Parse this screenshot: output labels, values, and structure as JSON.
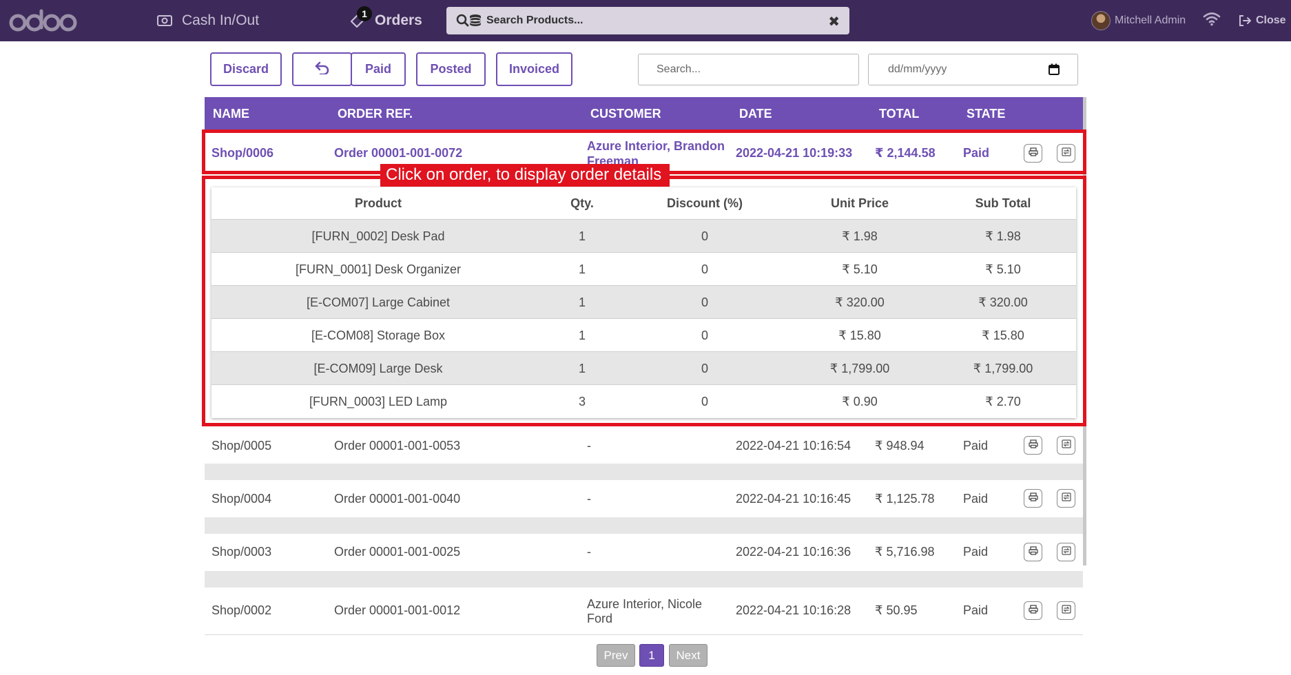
{
  "navbar": {
    "logo_text": "odoo",
    "cash_label": "Cash In/Out",
    "orders_label": "Orders",
    "orders_badge": "1",
    "search_products_label": "Search Products...",
    "clear_label": "✖",
    "user_name": "Mitchell Admin",
    "close_label": "Close"
  },
  "toolbar": {
    "discard": "Discard",
    "undo_icon": "undo-icon",
    "paid": "Paid",
    "posted": "Posted",
    "invoiced": "Invoiced",
    "search_placeholder": "Search...",
    "date_placeholder": "dd/mm/yyyy"
  },
  "table": {
    "headers": [
      "NAME",
      "ORDER REF.",
      "CUSTOMER",
      "DATE",
      "TOTAL",
      "STATE"
    ],
    "rows": [
      {
        "name": "Shop/0006",
        "ref": "Order 00001-001-0072",
        "customer1": "Azure Interior, Brandon",
        "customer2": "Freeman",
        "date": "2022-04-21 10:19:33",
        "total": "₹ 2,144.58",
        "state": "Paid"
      },
      {
        "name": "Shop/0005",
        "ref": "Order 00001-001-0053",
        "customer1": "-",
        "customer2": "",
        "date": "2022-04-21 10:16:54",
        "total": "₹ 948.94",
        "state": "Paid"
      },
      {
        "name": "Shop/0004",
        "ref": "Order 00001-001-0040",
        "customer1": "-",
        "customer2": "",
        "date": "2022-04-21 10:16:45",
        "total": "₹ 1,125.78",
        "state": "Paid"
      },
      {
        "name": "Shop/0003",
        "ref": "Order 00001-001-0025",
        "customer1": "-",
        "customer2": "",
        "date": "2022-04-21 10:16:36",
        "total": "₹ 5,716.98",
        "state": "Paid"
      },
      {
        "name": "Shop/0002",
        "ref": "Order 00001-001-0012",
        "customer1": "Azure Interior, Nicole",
        "customer2": "Ford",
        "date": "2022-04-21 10:16:28",
        "total": "₹ 50.95",
        "state": "Paid"
      }
    ]
  },
  "callout": "Click on order, to display order details",
  "details": {
    "headers": [
      "Product",
      "Qty.",
      "Discount (%)",
      "Unit Price",
      "Sub Total"
    ],
    "lines": [
      {
        "product": "[FURN_0002] Desk Pad",
        "qty": "1",
        "discount": "0",
        "unit_price": "₹ 1.98",
        "subtotal": "₹ 1.98"
      },
      {
        "product": "[FURN_0001] Desk Organizer",
        "qty": "1",
        "discount": "0",
        "unit_price": "₹ 5.10",
        "subtotal": "₹ 5.10"
      },
      {
        "product": "[E-COM07] Large Cabinet",
        "qty": "1",
        "discount": "0",
        "unit_price": "₹ 320.00",
        "subtotal": "₹ 320.00"
      },
      {
        "product": "[E-COM08] Storage Box",
        "qty": "1",
        "discount": "0",
        "unit_price": "₹ 15.80",
        "subtotal": "₹ 15.80"
      },
      {
        "product": "[E-COM09] Large Desk",
        "qty": "1",
        "discount": "0",
        "unit_price": "₹ 1,799.00",
        "subtotal": "₹ 1,799.00"
      },
      {
        "product": "[FURN_0003] LED Lamp",
        "qty": "3",
        "discount": "0",
        "unit_price": "₹ 0.90",
        "subtotal": "₹ 2.70"
      }
    ]
  },
  "pagination": {
    "prev": "Prev",
    "page": "1",
    "next": "Next"
  },
  "colors": {
    "brand": "#6f4fb4",
    "navbar": "#3d2a5a",
    "highlight": "#e0131f"
  }
}
